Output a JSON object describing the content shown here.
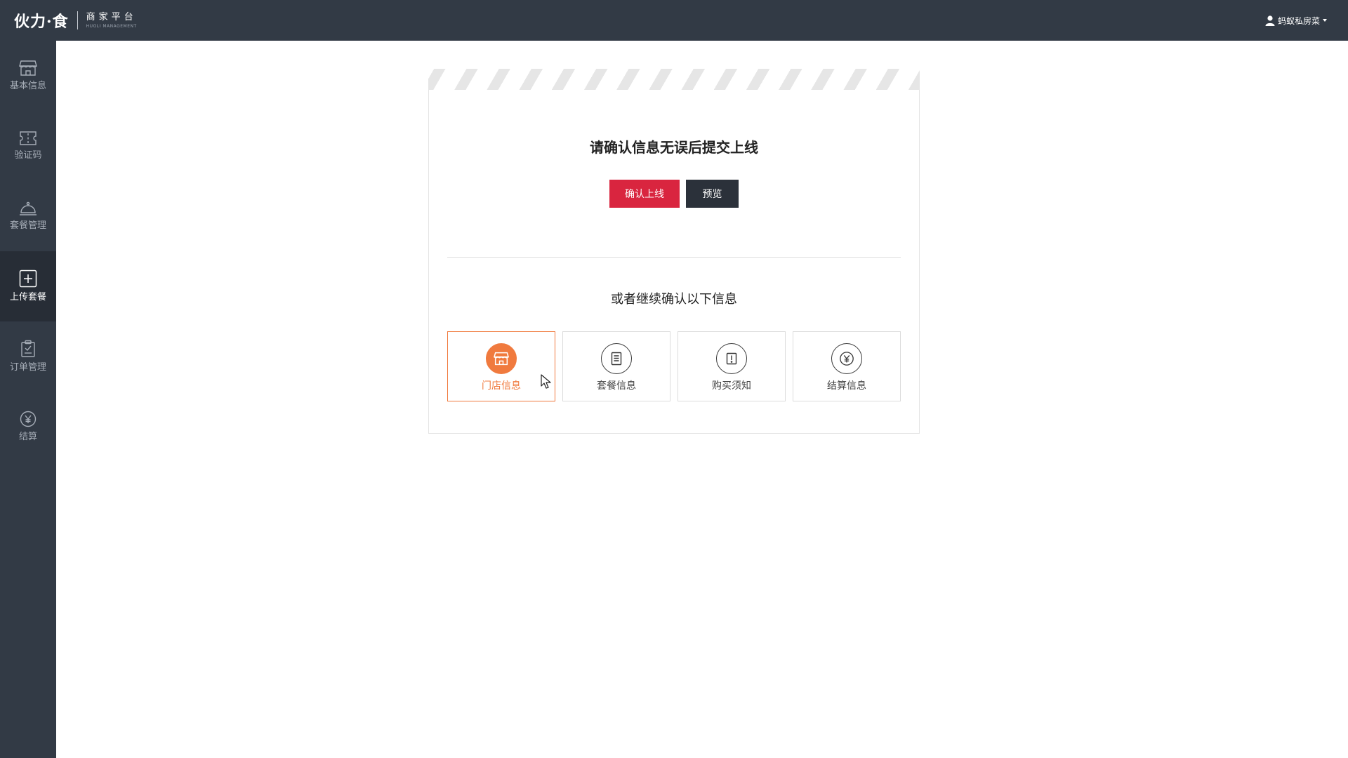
{
  "header": {
    "logo_text": "伙力·食",
    "platform": "商家平台",
    "platform_en": "HUOLI MANAGEMENT",
    "user_name": "蚂蚁私房菜"
  },
  "sidebar": {
    "items": [
      {
        "label": "基本信息",
        "icon": "store-icon",
        "active": false
      },
      {
        "label": "验证码",
        "icon": "ticket-icon",
        "active": false
      },
      {
        "label": "套餐管理",
        "icon": "cloche-icon",
        "active": false
      },
      {
        "label": "上传套餐",
        "icon": "plus-square-icon",
        "active": true
      },
      {
        "label": "订单管理",
        "icon": "clipboard-check-icon",
        "active": false
      },
      {
        "label": "结算",
        "icon": "yen-circle-icon",
        "active": false
      }
    ]
  },
  "main": {
    "confirm_title": "请确认信息无误后提交上线",
    "confirm_button": "确认上线",
    "preview_button": "预览",
    "continue_title": "或者继续确认以下信息",
    "tiles": [
      {
        "label": "门店信息",
        "icon": "store-icon",
        "active": true
      },
      {
        "label": "套餐信息",
        "icon": "document-icon",
        "active": false
      },
      {
        "label": "购买须知",
        "icon": "notice-icon",
        "active": false
      },
      {
        "label": "结算信息",
        "icon": "yen-circle-icon",
        "active": false
      }
    ]
  },
  "colors": {
    "topbar": "#323a45",
    "sidebar_active": "#272d36",
    "confirm_red": "#d9253f",
    "preview_dark": "#2b313a",
    "accent_orange": "#f07a3e"
  }
}
